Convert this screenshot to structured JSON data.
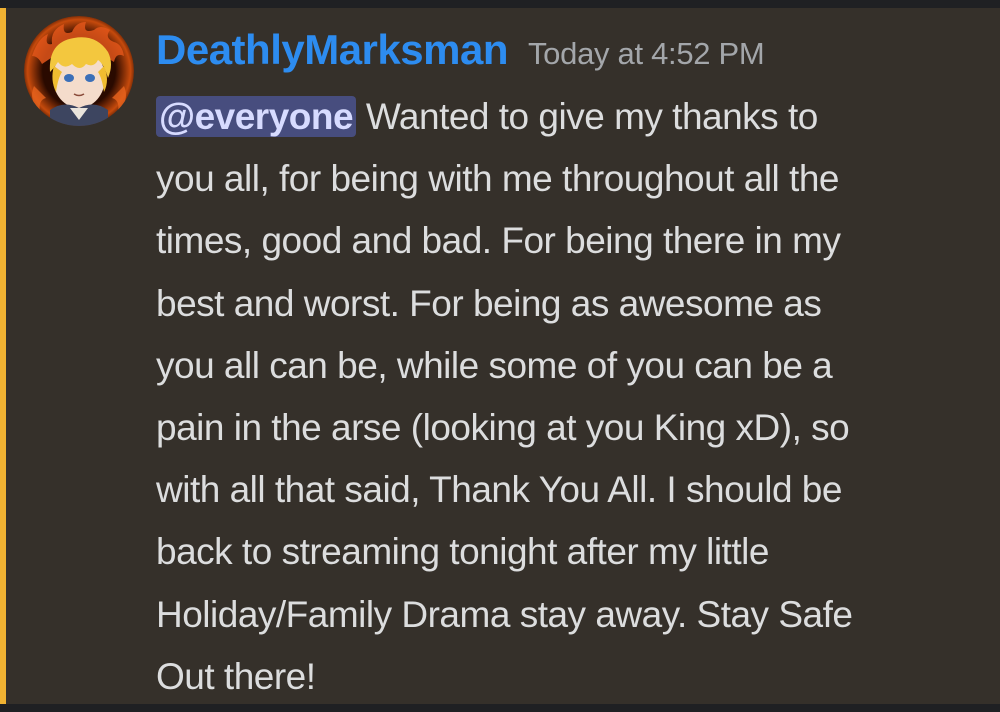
{
  "message": {
    "author": {
      "username": "DeathlyMarksman",
      "avatar_icon": "user-avatar-icon",
      "username_color": "#2d8cf0"
    },
    "timestamp": "Today at 4:52 PM",
    "mention": "@everyone",
    "mention_color": "#474d7e",
    "highlight_bar_color": "#f0b232",
    "text_lines": [
      " Wanted to give my thanks to",
      "you all, for being with me throughout all the",
      "times, good and bad. For being there in my",
      "best and worst. For being as awesome as",
      "you all can be, while some of you can be a",
      "pain in the arse (looking at you King xD), so",
      "with all that said, Thank You All. I should be",
      "back to streaming tonight after my little",
      "Holiday/Family Drama stay away. Stay Safe",
      "Out there!"
    ]
  }
}
